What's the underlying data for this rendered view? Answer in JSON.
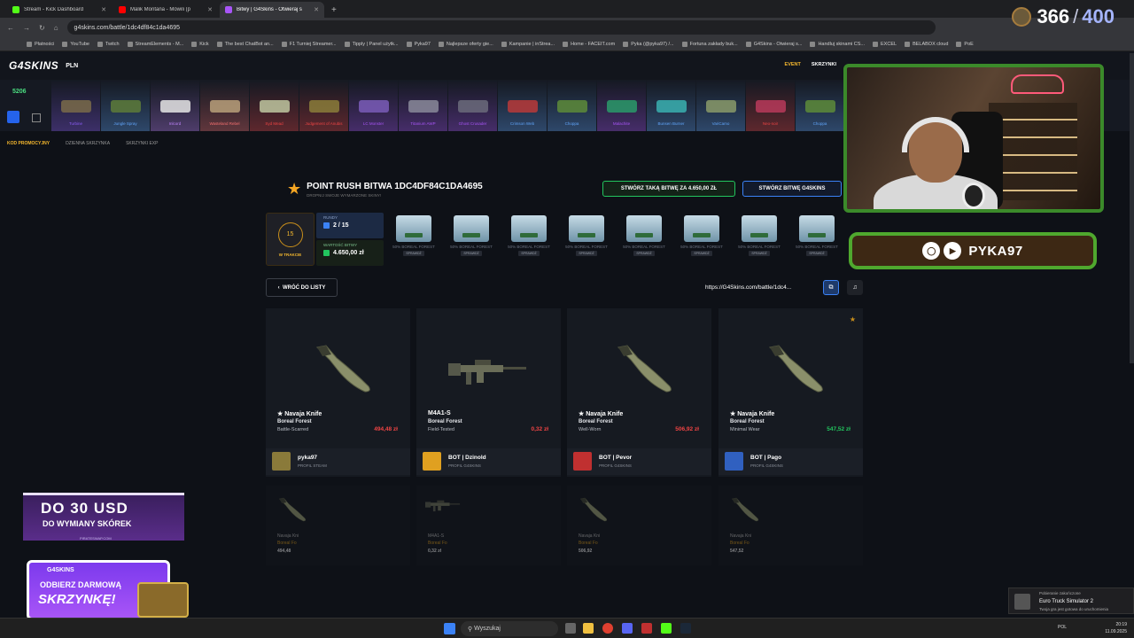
{
  "browser": {
    "tabs": [
      {
        "label": "Stream - Kick Dashboard",
        "color": "#53fc18"
      },
      {
        "label": "Malik Montana - Mówili (p",
        "color": "#ff0000"
      },
      {
        "label": "Bitwy | G4Skins - Otwieraj s",
        "color": "#a855f7"
      }
    ],
    "url": "g4skins.com/battle/1dc4df84c1da4695",
    "bookmarks": [
      "Płatności",
      "YouTube",
      "Twitch",
      "StreamElements - M...",
      "Kick",
      "The best ChatBot an...",
      "F1 Turniej Streamer...",
      "Tipply | Panel użytk...",
      "Pyka97",
      "Najlepsze oferty gie...",
      "Kampanie | inStrea...",
      "Home - FACEIT.com",
      "Pyka (@pyka97) /...",
      "Fortuna zakłady buk...",
      "G4Skins - Otwieraj s...",
      "Handluj skinami CS...",
      "EXCEL",
      "BELABOX cloud",
      "PoE"
    ]
  },
  "site": {
    "logo": "G4SKINS",
    "currency": "PLN",
    "header_links": {
      "event": "EVENT",
      "cases": "SKRZYNKI"
    },
    "balance": "5206",
    "drops": [
      {
        "name": "Turbine",
        "color": "#8b5cf6",
        "gun": "#7a6b4a"
      },
      {
        "name": "Jungle Spray",
        "color": "#60a5fa",
        "gun": "#5d7b3a"
      },
      {
        "name": "Inlcord",
        "color": "#c084fc",
        "gun": "#e5e5e5"
      },
      {
        "name": "Wasteland Rebel",
        "color": "#f87171",
        "gun": "#b8a07a"
      },
      {
        "name": "Syd Mead",
        "color": "#ef4444",
        "gun": "#c0c7a0"
      },
      {
        "name": "Judgement of Anubis",
        "color": "#ef4444",
        "gun": "#8b7d3a"
      },
      {
        "name": "LC Monster",
        "color": "#a855f7",
        "gun": "#7a5cb8"
      },
      {
        "name": "Titanium AWP",
        "color": "#a855f7",
        "gun": "#8a8a9a"
      },
      {
        "name": "Ghost Crusader",
        "color": "#a855f7",
        "gun": "#6b6b7b"
      },
      {
        "name": "Crimson Web",
        "color": "#60a5fa",
        "gun": "#b83a3a"
      },
      {
        "name": "Choppa",
        "color": "#60a5fa",
        "gun": "#5d8b3a"
      },
      {
        "name": "Malachite",
        "color": "#a855f7",
        "gun": "#2a9a6a"
      },
      {
        "name": "Bunsen Burner",
        "color": "#60a5fa",
        "gun": "#3ab0b0"
      },
      {
        "name": "VariCamo",
        "color": "#60a5fa",
        "gun": "#8a9a6a"
      },
      {
        "name": "Neo-noir",
        "color": "#ef4444",
        "gun": "#b83a5a"
      },
      {
        "name": "Choppa",
        "color": "#60a5fa",
        "gun": "#5d8b3a"
      }
    ],
    "subnav": {
      "promo": "KOD PROMOCYJNY",
      "daily": "DZIENNA SKRZYNKA",
      "exp": "SKRZYNKI EXP"
    }
  },
  "battle": {
    "title": "POINT RUSH BITWA 1DC4DF84C1DA4695",
    "subtitle": "DROPNIJ SWOJE WYMARZONE SKINY!",
    "create_same": "STWÓRZ TAKĄ BITWĘ ZA 4.650,00 ZŁ",
    "create_g4": "STWÓRZ BITWĘ G4SKINS",
    "round_num": "15",
    "status": "W TRAKCIE",
    "rounds_label": "RUNDY",
    "rounds_value": "2 / 15",
    "value_label": "WARTOŚĆ BITWY",
    "value": "4.650,00 zł",
    "case_name": "50% BOREAL FOREST",
    "case_status": "SPRAWDŹ",
    "case_count": 8,
    "back": "WRÓĆ DO LISTY",
    "link": "https://G4Skins.com/battle/1dc4..."
  },
  "cards": [
    {
      "name": "★ Navaja Knife",
      "skin": "Boreal Forest",
      "wear": "Battle-Scarred",
      "price": "494,48 zł",
      "price_color": "#ef4444",
      "user": "pyka97",
      "profile": "PROFIL STEAM",
      "avatar": "#8a7a3a",
      "knife": true
    },
    {
      "name": "M4A1-S",
      "skin": "Boreal Forest",
      "wear": "Field-Tested",
      "price": "0,32 zł",
      "price_color": "#ef4444",
      "user": "BOT | Dzinold",
      "profile": "PROFIL G4SKINS",
      "avatar": "#e0a020",
      "knife": false
    },
    {
      "name": "★ Navaja Knife",
      "skin": "Boreal Forest",
      "wear": "Well-Worn",
      "price": "506,92 zł",
      "price_color": "#ef4444",
      "user": "BOT | Pevor",
      "profile": "PROFIL G4SKINS",
      "avatar": "#c03030",
      "knife": true
    },
    {
      "name": "★ Navaja Knife",
      "skin": "Boreal Forest",
      "wear": "Minimal Wear",
      "price": "547,52 zł",
      "price_color": "#22c55e",
      "user": "BOT | Pago",
      "profile": "PROFIL G4SKINS",
      "avatar": "#3060c0",
      "knife": true
    }
  ],
  "ghosts": [
    {
      "n": "Navaja Kni",
      "s": "Boreal Fo",
      "p": "494,48"
    },
    {
      "n": "M4A1-S",
      "s": "Boreal Fo",
      "p": "0,32 zł"
    },
    {
      "n": "Navaja Kni",
      "s": "Boreal Fo",
      "p": "506,92"
    },
    {
      "n": "Navaja Kni",
      "s": "Boreal Fo",
      "p": "547,52"
    }
  ],
  "stream": {
    "count": "366",
    "max": "400",
    "social_handle": "PYKA97",
    "ad1": {
      "big": "DO 30 USD",
      "mid": "DO WYMIANY SKÓREK",
      "small": "PIRATESWAP.COM"
    },
    "ad2": {
      "logo": "G4SKINS",
      "l1": "ODBIERZ DARMOWĄ",
      "l2": "SKRZYNKĘ!"
    }
  },
  "toast": {
    "t1": "Pobieranie zakończone",
    "t2": "Euro Truck Simulator 2",
    "t3": "Twoja gra jest gotowa do uruchomienia"
  },
  "taskbar": {
    "search": "Wyszukaj",
    "lang": "POL",
    "time": "20:19",
    "date": "11.09.2025"
  }
}
